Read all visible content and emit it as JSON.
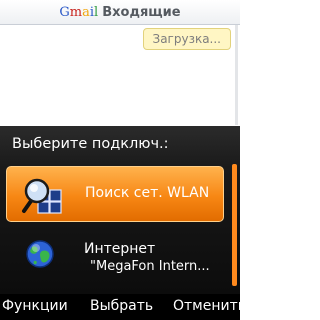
{
  "header": {
    "logo_letters": [
      "G",
      "m",
      "a",
      "i",
      "l"
    ],
    "logo_colors": [
      "#2a58c7",
      "#c8251f",
      "#f2a60d",
      "#2a58c7",
      "#2f9b3e"
    ],
    "title": "Входящие"
  },
  "background": {
    "loading_badge": "Загрузка..."
  },
  "dialog": {
    "title": "Выберите подключ.:",
    "options": [
      {
        "label": "Поиск сет. WLAN",
        "sublabel": "",
        "icon": "wlan-search-icon",
        "selected": true
      },
      {
        "label": "Интернет",
        "sublabel": "\"MegaFon Intern...",
        "icon": "globe-icon",
        "selected": false
      }
    ]
  },
  "softkeys": {
    "left": "Функции",
    "center": "Выбрать",
    "right": "Отменить"
  }
}
